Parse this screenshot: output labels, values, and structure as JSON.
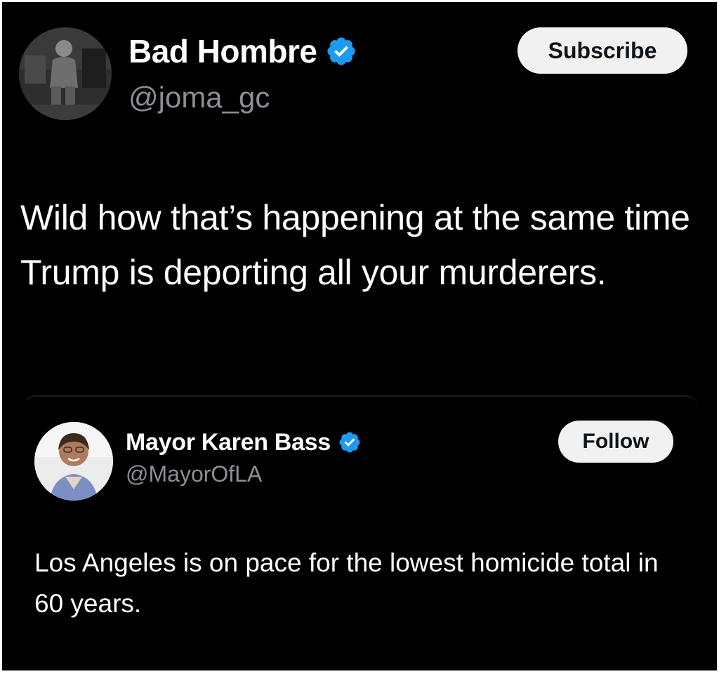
{
  "main_tweet": {
    "display_name": "Bad Hombre",
    "handle": "@joma_gc",
    "subscribe_label": "Subscribe",
    "text": "Wild how that’s happening at the same time Trump is deporting all your murderers.",
    "verified": true
  },
  "quoted_tweet": {
    "display_name": "Mayor Karen Bass",
    "handle": "@MayorOfLA",
    "follow_label": "Follow",
    "text": "Los Angeles is on pace for the lowest homicide total in 60 years.",
    "verified": true
  },
  "colors": {
    "background": "#000000",
    "text": "#ffffff",
    "handle": "#8b8f94",
    "verified_badge": "#1d9bf0",
    "button_bg": "#f1f1f1",
    "button_text": "#0f1419"
  },
  "icons": {
    "verified": "verified-badge-icon"
  }
}
